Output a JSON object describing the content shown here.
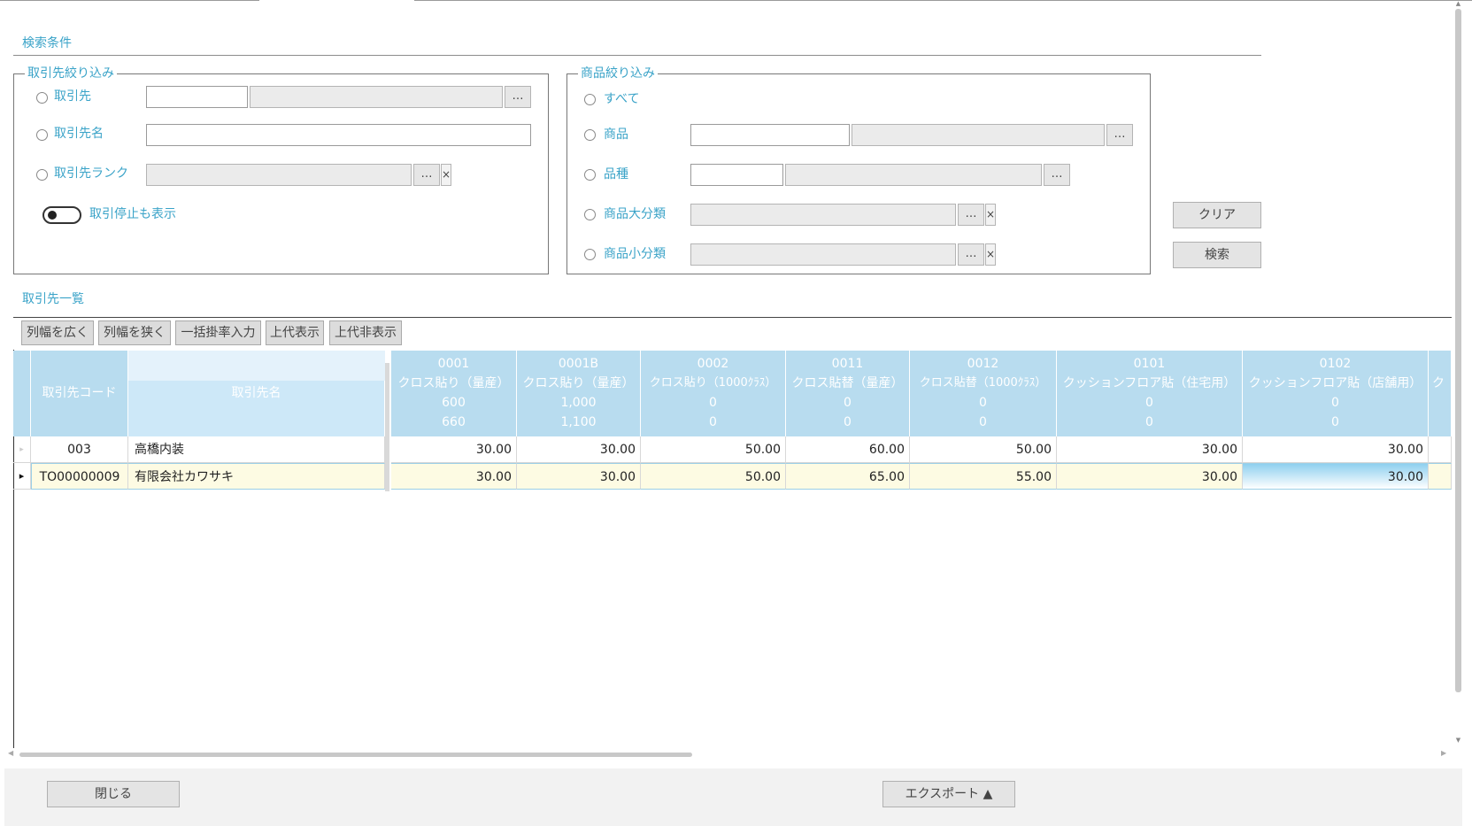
{
  "search": {
    "title": "検索条件",
    "partner_group": {
      "legend": "取引先絞り込み",
      "opt_partner": "取引先",
      "opt_partner_name": "取引先名",
      "opt_partner_rank": "取引先ランク",
      "show_suspended": "取引停止も表示"
    },
    "product_group": {
      "legend": "商品絞り込み",
      "opt_all": "すべて",
      "opt_product": "商品",
      "opt_variety": "品種",
      "opt_major_category": "商品大分類",
      "opt_minor_category": "商品小分類"
    },
    "clear_label": "クリア",
    "search_label": "検索"
  },
  "list": {
    "title": "取引先一覧",
    "toolbar": {
      "widen": "列幅を広く",
      "narrow": "列幅を狭く",
      "bulk_rate": "一括掛率入力",
      "show_upper": "上代表示",
      "hide_upper": "上代非表示"
    },
    "col_code": "取引先コード",
    "col_name": "取引先名",
    "products": [
      {
        "code": "0001",
        "name": "クロス貼り（量産）",
        "v1": "600",
        "v2": "660"
      },
      {
        "code": "0001B",
        "name": "クロス貼り（量産）",
        "v1": "1,000",
        "v2": "1,100"
      },
      {
        "code": "0002",
        "name": "クロス貼り（1000ｸﾗｽ）",
        "v1": "0",
        "v2": "0"
      },
      {
        "code": "0011",
        "name": "クロス貼替（量産）",
        "v1": "0",
        "v2": "0"
      },
      {
        "code": "0012",
        "name": "クロス貼替（1000ｸﾗｽ）",
        "v1": "0",
        "v2": "0"
      },
      {
        "code": "0101",
        "name": "クッションフロア貼（住宅用）",
        "v1": "0",
        "v2": "0"
      },
      {
        "code": "0102",
        "name": "クッションフロア貼（店舗用）",
        "v1": "0",
        "v2": "0"
      },
      {
        "code": "",
        "name": "ク",
        "v1": "",
        "v2": ""
      }
    ],
    "rows": [
      {
        "code": "003",
        "name": "高橋内装",
        "values": [
          "30.00",
          "30.00",
          "50.00",
          "60.00",
          "50.00",
          "30.00",
          "30.00"
        ]
      },
      {
        "code": "TO00000009",
        "name": "有限会社カワサキ",
        "values": [
          "30.00",
          "30.00",
          "50.00",
          "65.00",
          "55.00",
          "30.00",
          "30.00"
        ]
      }
    ]
  },
  "footer": {
    "close_label": "閉じる",
    "export_label": "エクスポート ▲"
  },
  "icons": {
    "dots": "…",
    "clear_x": "×",
    "row_pointer": "▸"
  },
  "colors": {
    "accent": "#3aa3c8",
    "header_bg": "#b8dcef",
    "selected_row": "#fdfbe3"
  }
}
